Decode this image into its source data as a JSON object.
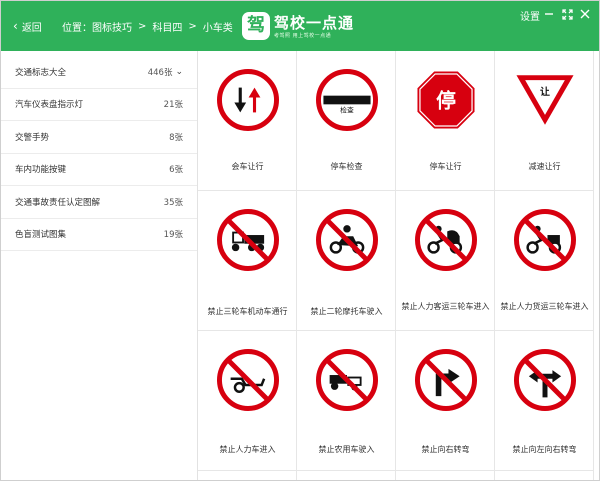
{
  "header": {
    "back_label": "返回",
    "breadcrumb": [
      "位置：图标技巧",
      "科目四",
      "小车类"
    ],
    "logo_mark": "驾",
    "logo_title": "驾校一点通",
    "logo_slogan": "考驾照  用上驾校一点通",
    "settings_label": "设置",
    "brand_color": "#2fb15a"
  },
  "sidebar": {
    "items": [
      {
        "label": "交通标志大全",
        "count": "446张"
      },
      {
        "label": "汽车仪表盘指示灯",
        "count": "21张"
      },
      {
        "label": "交警手势",
        "count": "8张"
      },
      {
        "label": "车内功能按键",
        "count": "6张"
      },
      {
        "label": "交通事故责任认定图解",
        "count": "35张"
      },
      {
        "label": "色盲测试图集",
        "count": "19张"
      }
    ]
  },
  "signs": [
    {
      "label": "会车让行",
      "icon": "two-way-yield-sign"
    },
    {
      "label": "停车检查",
      "icon": "stop-for-inspection-sign",
      "text": "检查"
    },
    {
      "label": "停车让行",
      "icon": "stop-octagon-sign",
      "text": "停"
    },
    {
      "label": "减速让行",
      "icon": "slow-yield-triangle-sign",
      "text": "让"
    },
    {
      "label": "禁止三轮车机动车通行",
      "icon": "no-motor-tricycle-sign"
    },
    {
      "label": "禁止二轮摩托车驶入",
      "icon": "no-motorcycle-sign"
    },
    {
      "label": "禁止人力客运三轮车进入",
      "icon": "no-passenger-pedicab-sign"
    },
    {
      "label": "禁止人力货运三轮车进入",
      "icon": "no-cargo-pedicab-sign"
    },
    {
      "label": "禁止人力车进入",
      "icon": "no-handcart-sign"
    },
    {
      "label": "禁止农用车驶入",
      "icon": "no-farm-vehicle-sign"
    },
    {
      "label": "禁止向右转弯",
      "icon": "no-right-turn-sign"
    },
    {
      "label": "禁止向左向右转弯",
      "icon": "no-left-right-turn-sign"
    }
  ],
  "colors": {
    "sign_red": "#d7000f",
    "sign_black": "#111111"
  }
}
